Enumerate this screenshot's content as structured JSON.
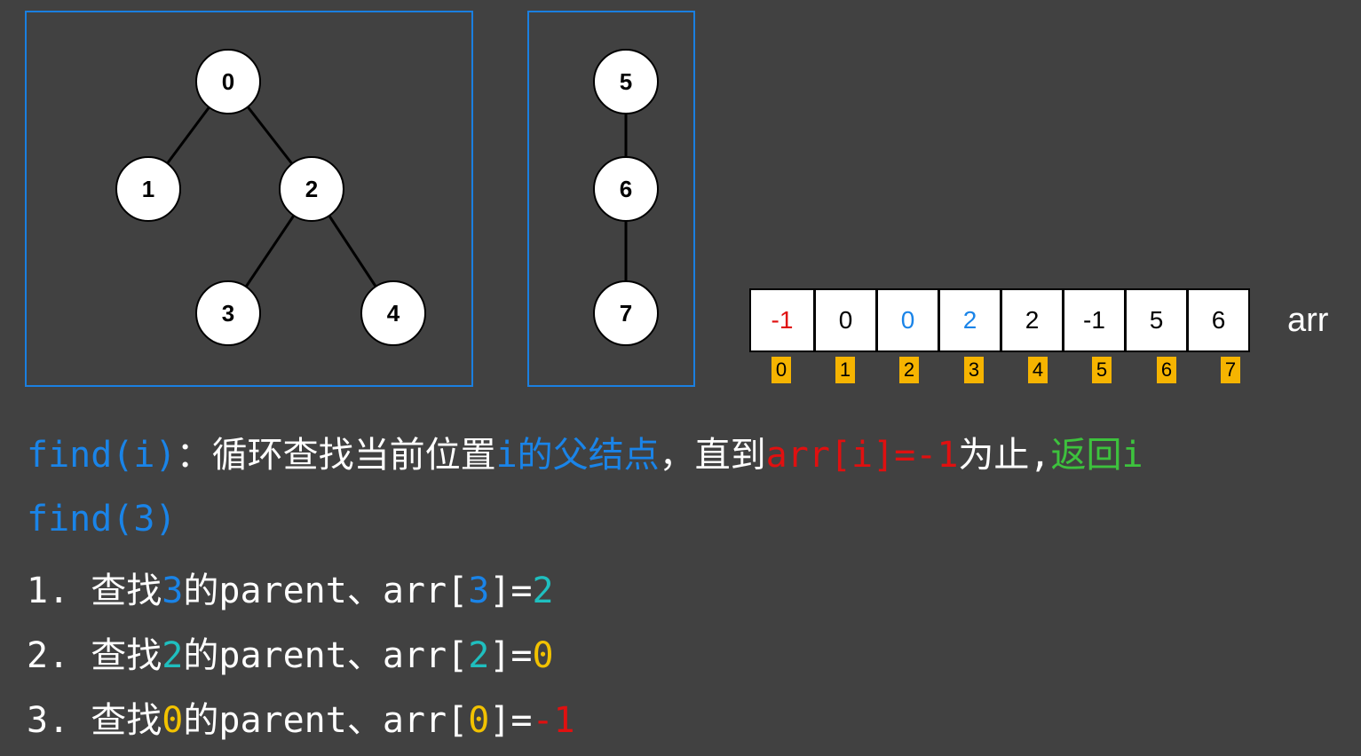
{
  "tree1": {
    "nodes": [
      "0",
      "1",
      "2",
      "3",
      "4"
    ]
  },
  "tree2": {
    "nodes": [
      "5",
      "6",
      "7"
    ]
  },
  "array": {
    "name": "arr",
    "values": [
      "-1",
      "0",
      "0",
      "2",
      "2",
      "-1",
      "5",
      "6"
    ],
    "value_colors": [
      "#e01010",
      "#000000",
      "#1a84e8",
      "#1a84e8",
      "#000000",
      "#000000",
      "#000000",
      "#000000"
    ],
    "indices": [
      "0",
      "1",
      "2",
      "3",
      "4",
      "5",
      "6",
      "7"
    ],
    "index_color": "#f6b400"
  },
  "text": {
    "line1": {
      "func": "find(i)",
      "colon": "：",
      "desc_a": "循环查找当前位置",
      "i_var": "i",
      "desc_b": "的父结点",
      "comma": "，",
      "desc_c": "直到",
      "cond": "arr[i]=-1",
      "desc_d": "为止,",
      "ret": "返回i"
    },
    "line2": "find(3)",
    "steps": [
      {
        "num": "1.",
        "a": "查找",
        "v": "3",
        "b": "的parent、arr[",
        "v2": "3",
        "c": "]=",
        "r": "2"
      },
      {
        "num": "2.",
        "a": "查找",
        "v": "2",
        "b": "的parent、arr[",
        "v2": "2",
        "c": "]=",
        "r": "0"
      },
      {
        "num": "3.",
        "a": "查找",
        "v": "0",
        "b": "的parent、arr[",
        "v2": "0",
        "c": "]=",
        "r": "-1"
      }
    ]
  },
  "colors": {
    "background": "#414141",
    "panel_border": "#1a7fe0",
    "blue": "#1a84e8",
    "red": "#e01010",
    "green": "#3dc23d",
    "teal": "#1fbfbf",
    "yellow": "#f2c200"
  }
}
